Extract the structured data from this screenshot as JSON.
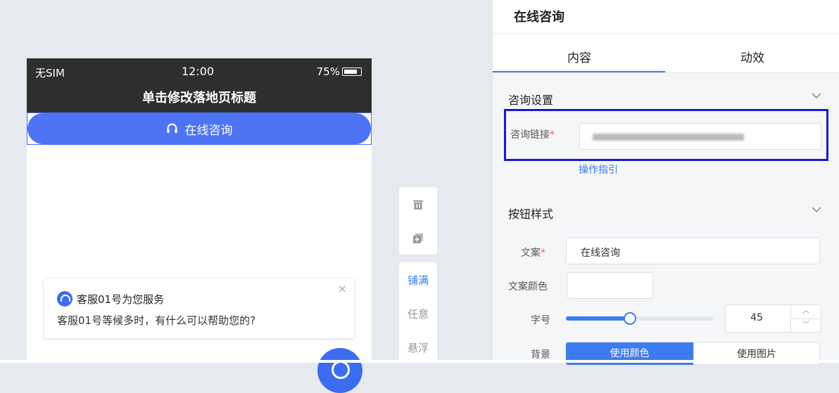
{
  "phone": {
    "carrier": "无SIM",
    "time": "12:00",
    "battery": "75%",
    "page_title": "单击修改落地页标题",
    "consult_button_label": "在线咨询"
  },
  "chat_popup": {
    "close_symbol": "×",
    "agent_name": "客服01号为您服务",
    "message": "客服01号等候多时，有什么可以帮助您的?"
  },
  "side_toolbar": {
    "icons": [
      "trash-icon",
      "copy-add-icon"
    ],
    "layout_options": [
      "铺满",
      "任意",
      "悬浮"
    ],
    "active_option": "铺满",
    "accent_color": "#3d7bf0"
  },
  "panel": {
    "title": "在线咨询",
    "tabs": [
      {
        "label": "内容",
        "active": true
      },
      {
        "label": "动效",
        "active": false
      }
    ],
    "consult_settings": {
      "section_title": "咨询设置",
      "link_label": "咨询链接",
      "required_mark": "*",
      "guide_link": "操作指引"
    },
    "button_style": {
      "section_title": "按钮样式",
      "text_label": "文案",
      "text_value": "在线咨询",
      "text_color_label": "文案颜色",
      "font_size_label": "字号",
      "font_size_value": "45",
      "font_size_fraction": 0.42,
      "background_label": "背景",
      "bg_option_color": "使用颜色",
      "bg_option_image": "使用图片",
      "bg_selected": "使用颜色"
    }
  },
  "colors": {
    "brand_blue": "#4d74f5",
    "highlight_box": "#1a1acf",
    "phone_header": "#2e2e2e"
  }
}
